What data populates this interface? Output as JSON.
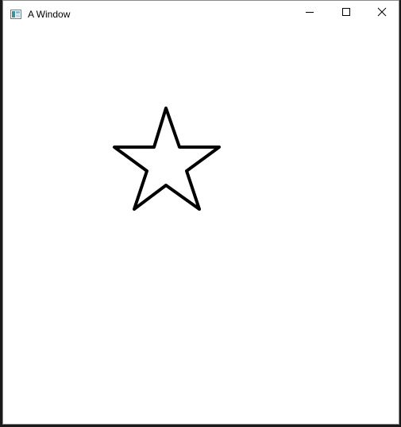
{
  "window": {
    "title": "A Window",
    "icons": {
      "app": "app-window-icon",
      "minimize": "minimize-icon",
      "maximize": "maximize-icon",
      "close": "close-icon"
    }
  },
  "canvas": {
    "background": "#ffffff",
    "shape": "star",
    "stroke_color": "#000000",
    "fill_color": "#ffffff"
  }
}
